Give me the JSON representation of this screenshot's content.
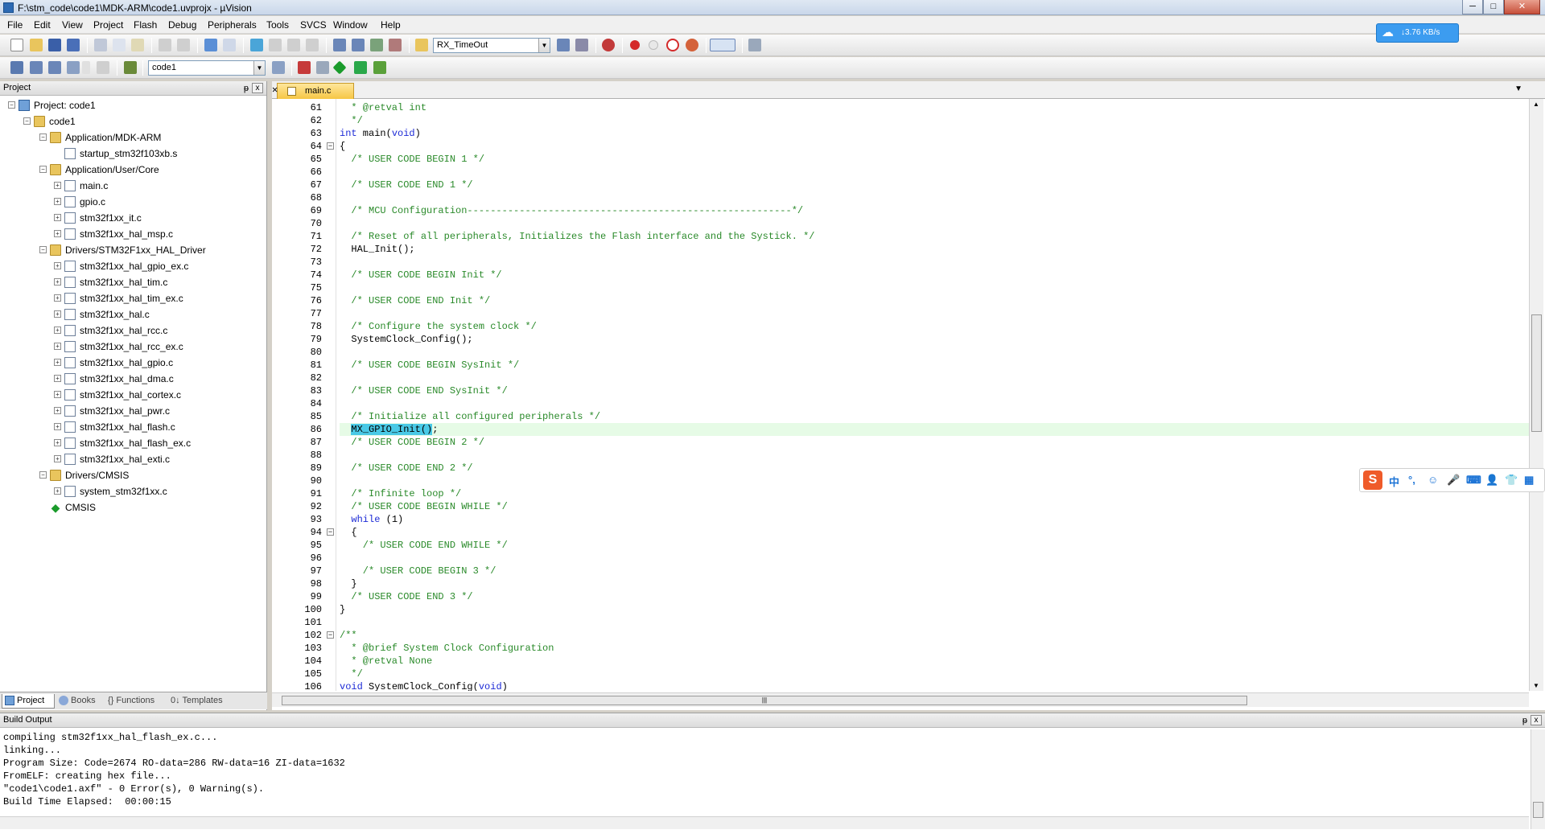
{
  "window": {
    "title": "F:\\stm_code\\code1\\MDK-ARM\\code1.uvprojx - µVision",
    "min": "─",
    "max": "□",
    "close": "✕"
  },
  "menu": [
    "File",
    "Edit",
    "View",
    "Project",
    "Flash",
    "Debug",
    "Peripherals",
    "Tools",
    "SVCS",
    "Window",
    "Help"
  ],
  "toolbar1": {
    "target_combo": "RX_TimeOut"
  },
  "toolbar2": {
    "target_combo": "code1"
  },
  "cloud_badge": {
    "text": "↓3.76 KB/s"
  },
  "project_panel": {
    "title": "Project",
    "pin": "ᵽ",
    "close": "x",
    "tree": [
      {
        "label": "Project: code1",
        "level": 0,
        "icon": "project-icon",
        "expander": "−"
      },
      {
        "label": "code1",
        "level": 1,
        "icon": "target-folder-icon",
        "expander": "−"
      },
      {
        "label": "Application/MDK-ARM",
        "level": 2,
        "icon": "folder-icon",
        "expander": "−"
      },
      {
        "label": "startup_stm32f103xb.s",
        "level": 3,
        "icon": "file-icon",
        "expander": ""
      },
      {
        "label": "Application/User/Core",
        "level": 2,
        "icon": "folder-icon",
        "expander": "−"
      },
      {
        "label": "main.c",
        "level": 3,
        "icon": "file-icon",
        "expander": "+"
      },
      {
        "label": "gpio.c",
        "level": 3,
        "icon": "file-icon",
        "expander": "+"
      },
      {
        "label": "stm32f1xx_it.c",
        "level": 3,
        "icon": "file-icon",
        "expander": "+"
      },
      {
        "label": "stm32f1xx_hal_msp.c",
        "level": 3,
        "icon": "file-icon",
        "expander": "+"
      },
      {
        "label": "Drivers/STM32F1xx_HAL_Driver",
        "level": 2,
        "icon": "folder-icon",
        "expander": "−"
      },
      {
        "label": "stm32f1xx_hal_gpio_ex.c",
        "level": 3,
        "icon": "file-icon",
        "expander": "+"
      },
      {
        "label": "stm32f1xx_hal_tim.c",
        "level": 3,
        "icon": "file-icon",
        "expander": "+"
      },
      {
        "label": "stm32f1xx_hal_tim_ex.c",
        "level": 3,
        "icon": "file-icon",
        "expander": "+"
      },
      {
        "label": "stm32f1xx_hal.c",
        "level": 3,
        "icon": "file-icon",
        "expander": "+"
      },
      {
        "label": "stm32f1xx_hal_rcc.c",
        "level": 3,
        "icon": "file-icon",
        "expander": "+"
      },
      {
        "label": "stm32f1xx_hal_rcc_ex.c",
        "level": 3,
        "icon": "file-icon",
        "expander": "+"
      },
      {
        "label": "stm32f1xx_hal_gpio.c",
        "level": 3,
        "icon": "file-icon",
        "expander": "+"
      },
      {
        "label": "stm32f1xx_hal_dma.c",
        "level": 3,
        "icon": "file-icon",
        "expander": "+"
      },
      {
        "label": "stm32f1xx_hal_cortex.c",
        "level": 3,
        "icon": "file-icon",
        "expander": "+"
      },
      {
        "label": "stm32f1xx_hal_pwr.c",
        "level": 3,
        "icon": "file-icon",
        "expander": "+"
      },
      {
        "label": "stm32f1xx_hal_flash.c",
        "level": 3,
        "icon": "file-icon",
        "expander": "+"
      },
      {
        "label": "stm32f1xx_hal_flash_ex.c",
        "level": 3,
        "icon": "file-icon",
        "expander": "+"
      },
      {
        "label": "stm32f1xx_hal_exti.c",
        "level": 3,
        "icon": "file-icon",
        "expander": "+"
      },
      {
        "label": "Drivers/CMSIS",
        "level": 2,
        "icon": "folder-icon",
        "expander": "−"
      },
      {
        "label": "system_stm32f1xx.c",
        "level": 3,
        "icon": "file-icon",
        "expander": "+"
      },
      {
        "label": "CMSIS",
        "level": 2,
        "icon": "cmsis-gem-icon",
        "expander": ""
      }
    ],
    "tabs": [
      {
        "label": "Project",
        "name": "tab-project"
      },
      {
        "label": "Books",
        "name": "tab-books"
      },
      {
        "label": "{} Functions",
        "name": "tab-functions"
      },
      {
        "label": "0↓ Templates",
        "name": "tab-templates"
      }
    ]
  },
  "editor": {
    "tab_label": "main.c",
    "lines": [
      {
        "n": "61",
        "fold": "",
        "segs": [
          {
            "t": "  * @retval int",
            "c": "cm"
          }
        ]
      },
      {
        "n": "62",
        "fold": "",
        "segs": [
          {
            "t": "  */",
            "c": "cm"
          }
        ]
      },
      {
        "n": "63",
        "fold": "",
        "segs": [
          {
            "t": "int",
            "c": "kw"
          },
          {
            "t": " main(",
            "c": ""
          },
          {
            "t": "void",
            "c": "kw"
          },
          {
            "t": ")",
            "c": ""
          }
        ]
      },
      {
        "n": "64",
        "fold": "−",
        "segs": [
          {
            "t": "{",
            "c": ""
          }
        ]
      },
      {
        "n": "65",
        "fold": "",
        "segs": [
          {
            "t": "  /* USER CODE BEGIN 1 */",
            "c": "cm"
          }
        ]
      },
      {
        "n": "66",
        "fold": "",
        "segs": []
      },
      {
        "n": "67",
        "fold": "",
        "segs": [
          {
            "t": "  /* USER CODE END 1 */",
            "c": "cm"
          }
        ]
      },
      {
        "n": "68",
        "fold": "",
        "segs": []
      },
      {
        "n": "69",
        "fold": "",
        "segs": [
          {
            "t": "  /* MCU Configuration--------------------------------------------------------*/",
            "c": "cm"
          }
        ]
      },
      {
        "n": "70",
        "fold": "",
        "segs": []
      },
      {
        "n": "71",
        "fold": "",
        "segs": [
          {
            "t": "  /* Reset of all peripherals, Initializes the Flash interface and the Systick. */",
            "c": "cm"
          }
        ]
      },
      {
        "n": "72",
        "fold": "",
        "segs": [
          {
            "t": "  HAL_Init();",
            "c": ""
          }
        ]
      },
      {
        "n": "73",
        "fold": "",
        "segs": []
      },
      {
        "n": "74",
        "fold": "",
        "segs": [
          {
            "t": "  /* USER CODE BEGIN Init */",
            "c": "cm"
          }
        ]
      },
      {
        "n": "75",
        "fold": "",
        "segs": []
      },
      {
        "n": "76",
        "fold": "",
        "segs": [
          {
            "t": "  /* USER CODE END Init */",
            "c": "cm"
          }
        ]
      },
      {
        "n": "77",
        "fold": "",
        "segs": []
      },
      {
        "n": "78",
        "fold": "",
        "segs": [
          {
            "t": "  /* Configure the system clock */",
            "c": "cm"
          }
        ]
      },
      {
        "n": "79",
        "fold": "",
        "segs": [
          {
            "t": "  SystemClock_Config();",
            "c": ""
          }
        ]
      },
      {
        "n": "80",
        "fold": "",
        "segs": []
      },
      {
        "n": "81",
        "fold": "",
        "segs": [
          {
            "t": "  /* USER CODE BEGIN SysInit */",
            "c": "cm"
          }
        ]
      },
      {
        "n": "82",
        "fold": "",
        "segs": []
      },
      {
        "n": "83",
        "fold": "",
        "segs": [
          {
            "t": "  /* USER CODE END SysInit */",
            "c": "cm"
          }
        ]
      },
      {
        "n": "84",
        "fold": "",
        "segs": []
      },
      {
        "n": "85",
        "fold": "",
        "segs": [
          {
            "t": "  /* Initialize all configured peripherals */",
            "c": "cm"
          }
        ]
      },
      {
        "n": "86",
        "fold": "",
        "hl": true,
        "segs": [
          {
            "t": "  ",
            "c": ""
          },
          {
            "t": "MX_GPIO_Init",
            "c": "sel"
          },
          {
            "t": "()",
            "c": "sel"
          },
          {
            "t": ";",
            "c": ""
          }
        ]
      },
      {
        "n": "87",
        "fold": "",
        "segs": [
          {
            "t": "  /* USER CODE BEGIN 2 */",
            "c": "cm"
          }
        ]
      },
      {
        "n": "88",
        "fold": "",
        "segs": []
      },
      {
        "n": "89",
        "fold": "",
        "segs": [
          {
            "t": "  /* USER CODE END 2 */",
            "c": "cm"
          }
        ]
      },
      {
        "n": "90",
        "fold": "",
        "segs": []
      },
      {
        "n": "91",
        "fold": "",
        "segs": [
          {
            "t": "  /* Infinite loop */",
            "c": "cm"
          }
        ]
      },
      {
        "n": "92",
        "fold": "",
        "segs": [
          {
            "t": "  /* USER CODE BEGIN WHILE */",
            "c": "cm"
          }
        ]
      },
      {
        "n": "93",
        "fold": "",
        "segs": [
          {
            "t": "  ",
            "c": ""
          },
          {
            "t": "while",
            "c": "kw"
          },
          {
            "t": " (1)",
            "c": ""
          }
        ]
      },
      {
        "n": "94",
        "fold": "−",
        "segs": [
          {
            "t": "  {",
            "c": ""
          }
        ]
      },
      {
        "n": "95",
        "fold": "",
        "segs": [
          {
            "t": "    /* USER CODE END WHILE */",
            "c": "cm"
          }
        ]
      },
      {
        "n": "96",
        "fold": "",
        "segs": []
      },
      {
        "n": "97",
        "fold": "",
        "segs": [
          {
            "t": "    /* USER CODE BEGIN 3 */",
            "c": "cm"
          }
        ]
      },
      {
        "n": "98",
        "fold": "",
        "segs": [
          {
            "t": "  }",
            "c": ""
          }
        ]
      },
      {
        "n": "99",
        "fold": "",
        "segs": [
          {
            "t": "  /* USER CODE END 3 */",
            "c": "cm"
          }
        ]
      },
      {
        "n": "100",
        "fold": "",
        "segs": [
          {
            "t": "}",
            "c": ""
          }
        ]
      },
      {
        "n": "101",
        "fold": "",
        "segs": []
      },
      {
        "n": "102",
        "fold": "−",
        "segs": [
          {
            "t": "/**",
            "c": "cm"
          }
        ]
      },
      {
        "n": "103",
        "fold": "",
        "segs": [
          {
            "t": "  * @brief System Clock Configuration",
            "c": "cm"
          }
        ]
      },
      {
        "n": "104",
        "fold": "",
        "segs": [
          {
            "t": "  * @retval None",
            "c": "cm"
          }
        ]
      },
      {
        "n": "105",
        "fold": "",
        "segs": [
          {
            "t": "  */",
            "c": "cm"
          }
        ]
      },
      {
        "n": "106",
        "fold": "",
        "segs": [
          {
            "t": "void",
            "c": "kw"
          },
          {
            "t": " SystemClock_Config(",
            "c": ""
          },
          {
            "t": "void",
            "c": "kw"
          },
          {
            "t": ")",
            "c": ""
          }
        ]
      }
    ]
  },
  "ime": {
    "lang": "中",
    "punct": "°,",
    "items": [
      "☺",
      "🎤",
      "⌨",
      "👤",
      "👕",
      "▦"
    ]
  },
  "build_output": {
    "title": "Build Output",
    "lines": [
      "compiling stm32f1xx_hal_flash_ex.c...",
      "linking...",
      "Program Size: Code=2674 RO-data=286 RW-data=16 ZI-data=1632",
      "FromELF: creating hex file...",
      "\"code1\\code1.axf\" - 0 Error(s), 0 Warning(s).",
      "Build Time Elapsed:  00:00:15"
    ]
  },
  "colors": {
    "comment": "#2a8a2a",
    "keyword": "#1c2ad6",
    "line_highlight": "#e6fbe6",
    "selection": "#49c9e6",
    "tab_active": "#f6c644"
  }
}
